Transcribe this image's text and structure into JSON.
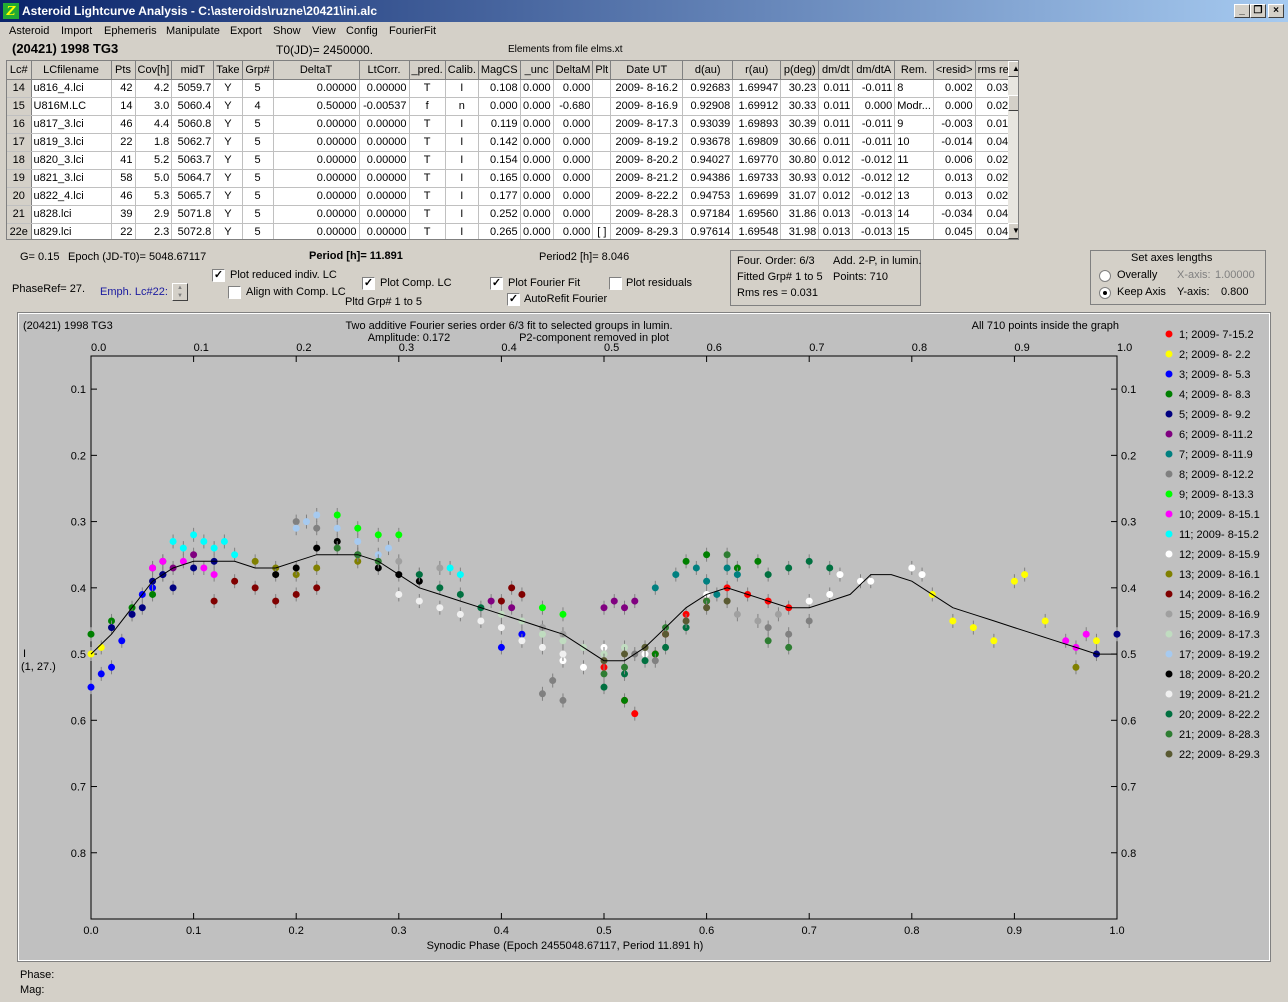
{
  "window": {
    "title": "Asteroid Lightcurve Analysis - C:\\asteroids\\ruzne\\20421\\ini.alc",
    "app_icon": "Z",
    "min_icon": "_",
    "restore_icon": "❐",
    "close_icon": "×"
  },
  "menu": [
    "Asteroid",
    "Import",
    "Ephemeris",
    "Manipulate",
    "Export",
    "Show",
    "View",
    "Config",
    "FourierFit"
  ],
  "header": {
    "object": "(20421) 1998 TG3",
    "t0": "T0(JD)= 2450000.",
    "elements": "Elements from file elms.xt"
  },
  "table": {
    "columns": [
      "Lc#",
      "LCfilename",
      "Pts",
      "Cov[h]",
      "midT",
      "Take",
      "Grp#",
      "DeltaT",
      "LtCorr.",
      "_pred.",
      "Calib.",
      "MagCS",
      "_unc",
      "DeltaM",
      "Plt",
      "Date UT",
      "d(au)",
      "r(au)",
      "p(deg)",
      "dm/dt",
      "dm/dtA",
      "Rem.",
      "<resid>",
      "rms res"
    ],
    "rows": [
      [
        "14",
        "u816_4.lci",
        "42",
        "4.2",
        "5059.7",
        "Y",
        "5",
        "0.00000",
        "0.00000",
        "T",
        "I",
        "0.108",
        "0.000",
        "0.000",
        "",
        "2009- 8-16.2",
        "0.92683",
        "1.69947",
        "30.23",
        "0.011",
        "-0.011",
        "8",
        "0.002",
        "0.032"
      ],
      [
        "15",
        "U816M.LC",
        "14",
        "3.0",
        "5060.4",
        "Y",
        "4",
        "0.50000",
        "-0.00537",
        "f",
        "n",
        "0.000",
        "0.000",
        "-0.680",
        "",
        "2009- 8-16.9",
        "0.92908",
        "1.69912",
        "30.33",
        "0.011",
        "0.000",
        "Modr...",
        "0.000",
        "0.023"
      ],
      [
        "16",
        "u817_3.lci",
        "46",
        "4.4",
        "5060.8",
        "Y",
        "5",
        "0.00000",
        "0.00000",
        "T",
        "I",
        "0.119",
        "0.000",
        "0.000",
        "",
        "2009- 8-17.3",
        "0.93039",
        "1.69893",
        "30.39",
        "0.011",
        "-0.011",
        "9",
        "-0.003",
        "0.015"
      ],
      [
        "17",
        "u819_3.lci",
        "22",
        "1.8",
        "5062.7",
        "Y",
        "5",
        "0.00000",
        "0.00000",
        "T",
        "I",
        "0.142",
        "0.000",
        "0.000",
        "",
        "2009- 8-19.2",
        "0.93678",
        "1.69809",
        "30.66",
        "0.011",
        "-0.011",
        "10",
        "-0.014",
        "0.042"
      ],
      [
        "18",
        "u820_3.lci",
        "41",
        "5.2",
        "5063.7",
        "Y",
        "5",
        "0.00000",
        "0.00000",
        "T",
        "I",
        "0.154",
        "0.000",
        "0.000",
        "",
        "2009- 8-20.2",
        "0.94027",
        "1.69770",
        "30.80",
        "0.012",
        "-0.012",
        "11",
        "0.006",
        "0.024"
      ],
      [
        "19",
        "u821_3.lci",
        "58",
        "5.0",
        "5064.7",
        "Y",
        "5",
        "0.00000",
        "0.00000",
        "T",
        "I",
        "0.165",
        "0.000",
        "0.000",
        "",
        "2009- 8-21.2",
        "0.94386",
        "1.69733",
        "30.93",
        "0.012",
        "-0.012",
        "12",
        "0.013",
        "0.021"
      ],
      [
        "20",
        "u822_4.lci",
        "46",
        "5.3",
        "5065.7",
        "Y",
        "5",
        "0.00000",
        "0.00000",
        "T",
        "I",
        "0.177",
        "0.000",
        "0.000",
        "",
        "2009- 8-22.2",
        "0.94753",
        "1.69699",
        "31.07",
        "0.012",
        "-0.012",
        "13",
        "0.013",
        "0.028"
      ],
      [
        "21",
        "u828.lci",
        "39",
        "2.9",
        "5071.8",
        "Y",
        "5",
        "0.00000",
        "0.00000",
        "T",
        "I",
        "0.252",
        "0.000",
        "0.000",
        "",
        "2009- 8-28.3",
        "0.97184",
        "1.69560",
        "31.86",
        "0.013",
        "-0.013",
        "14",
        "-0.034",
        "0.044"
      ],
      [
        "22e",
        "u829.lci",
        "22",
        "2.3",
        "5072.8",
        "Y",
        "5",
        "0.00000",
        "0.00000",
        "T",
        "I",
        "0.265",
        "0.000",
        "0.000",
        "[ ]",
        "2009- 8-29.3",
        "0.97614",
        "1.69548",
        "31.98",
        "0.013",
        "-0.013",
        "15",
        "0.045",
        "0.048"
      ]
    ]
  },
  "controls": {
    "g": "G= 0.15",
    "epoch": "Epoch (JD-T0)= 5048.67117",
    "period": "Period [h]= 11.891",
    "period2": "Period2 [h]= 8.046",
    "phaseref": "PhaseRef= 27.",
    "emph": "Emph. Lc#22:",
    "plot_reduced": "Plot reduced indiv. LC",
    "align": "Align with Comp. LC",
    "plot_comp": "Plot Comp. LC",
    "pltd_grp": "Pltd Grp#  1   to   5",
    "plot_fourier": "Plot Fourier Fit",
    "autorefit": "AutoRefit Fourier",
    "plot_resid": "Plot residuals",
    "check_mark": "✓"
  },
  "fourier_box": {
    "order": "Four. Order:  6/3",
    "add": "Add. 2-P, in lumin.",
    "fitted": "Fitted Grp# 1 to 5",
    "points": "Points: 710",
    "rms": "Rms res     = 0.031"
  },
  "axes_box": {
    "title": "Set axes lengths",
    "overall": "Overally",
    "keep": "Keep Axis",
    "xaxis_label": "X-axis:",
    "xaxis_value": "1.00000",
    "yaxis_label": "Y-axis:",
    "yaxis_value": "0.800"
  },
  "status": {
    "phase": "Phase:",
    "mag": "Mag:"
  },
  "chart_data": {
    "type": "scatter",
    "title_left": "(20421) 1998 TG3",
    "title_center": "Two additive Fourier series order 6/3 fit to selected groups in lumin.",
    "amplitude": "Amplitude: 0.172",
    "p2_note": "P2-component removed in plot",
    "title_right": "All 710 points inside the graph",
    "xlabel": "Synodic Phase (Epoch 2455048.67117, Period 11.891 h)",
    "ylabel": "I",
    "ylabel2": "(1, 27.)",
    "xlim": [
      0,
      1
    ],
    "ylim": [
      0.9,
      0.05
    ],
    "xticks": [
      "0.0",
      "0.1",
      "0.2",
      "0.3",
      "0.4",
      "0.5",
      "0.6",
      "0.7",
      "0.8",
      "0.9",
      "1.0"
    ],
    "yticks": [
      "0.1",
      "0.2",
      "0.3",
      "0.4",
      "0.5",
      "0.6",
      "0.7",
      "0.8"
    ],
    "series": [
      {
        "name": "1; 2009- 7-15.2",
        "color": "#ff0000",
        "x": [
          0.5,
          0.52,
          0.53,
          0.55,
          0.56,
          0.58,
          0.6,
          0.62,
          0.64,
          0.66,
          0.68
        ],
        "y": [
          0.52,
          0.57,
          0.59,
          0.5,
          0.47,
          0.44,
          0.42,
          0.4,
          0.41,
          0.42,
          0.43
        ]
      },
      {
        "name": "2; 2009- 8- 2.2",
        "color": "#ffff00",
        "x": [
          0.0,
          0.01,
          0.82,
          0.84,
          0.86,
          0.88,
          0.9,
          0.91,
          0.93,
          0.98
        ],
        "y": [
          0.5,
          0.49,
          0.41,
          0.45,
          0.46,
          0.48,
          0.39,
          0.38,
          0.45,
          0.48
        ]
      },
      {
        "name": "3; 2009- 8- 5.3",
        "color": "#0000ff",
        "x": [
          0.0,
          0.01,
          0.02,
          0.03,
          0.04,
          0.05,
          0.06,
          0.07,
          0.4,
          0.42
        ],
        "y": [
          0.55,
          0.53,
          0.52,
          0.48,
          0.44,
          0.41,
          0.4,
          0.38,
          0.49,
          0.47
        ]
      },
      {
        "name": "4; 2009- 8- 8.3",
        "color": "#007f00",
        "x": [
          0.0,
          0.02,
          0.04,
          0.06,
          0.52,
          0.55,
          0.58,
          0.6,
          0.63,
          0.65
        ],
        "y": [
          0.47,
          0.45,
          0.43,
          0.41,
          0.57,
          0.5,
          0.36,
          0.35,
          0.37,
          0.36
        ]
      },
      {
        "name": "5; 2009- 8- 9.2",
        "color": "#000080",
        "x": [
          0.02,
          0.04,
          0.05,
          0.06,
          0.07,
          0.08,
          0.1,
          0.12,
          0.98,
          1.0
        ],
        "y": [
          0.46,
          0.44,
          0.43,
          0.39,
          0.38,
          0.4,
          0.37,
          0.36,
          0.5,
          0.47
        ]
      },
      {
        "name": "6; 2009- 8-11.2",
        "color": "#800080",
        "x": [
          0.06,
          0.07,
          0.08,
          0.1,
          0.39,
          0.41,
          0.5,
          0.51,
          0.52,
          0.53
        ],
        "y": [
          0.37,
          0.36,
          0.37,
          0.35,
          0.42,
          0.43,
          0.43,
          0.42,
          0.43,
          0.42
        ]
      },
      {
        "name": "7; 2009- 8-11.9",
        "color": "#008080",
        "x": [
          0.55,
          0.57,
          0.59,
          0.6,
          0.61,
          0.62,
          0.63
        ],
        "y": [
          0.4,
          0.38,
          0.37,
          0.39,
          0.41,
          0.37,
          0.38
        ]
      },
      {
        "name": "8; 2009- 8-12.2",
        "color": "#808080",
        "x": [
          0.2,
          0.22,
          0.44,
          0.45,
          0.46,
          0.53,
          0.55,
          0.66,
          0.68,
          0.7
        ],
        "y": [
          0.3,
          0.31,
          0.56,
          0.54,
          0.57,
          0.5,
          0.51,
          0.46,
          0.47,
          0.45
        ]
      },
      {
        "name": "9; 2009- 8-13.3",
        "color": "#00ff00",
        "x": [
          0.24,
          0.26,
          0.28,
          0.3,
          0.44,
          0.46
        ],
        "y": [
          0.29,
          0.31,
          0.32,
          0.32,
          0.43,
          0.44
        ]
      },
      {
        "name": "10; 2009- 8-15.1",
        "color": "#ff00ff",
        "x": [
          0.06,
          0.07,
          0.09,
          0.11,
          0.12,
          0.95,
          0.96,
          0.97
        ],
        "y": [
          0.37,
          0.36,
          0.36,
          0.37,
          0.38,
          0.48,
          0.49,
          0.47
        ]
      },
      {
        "name": "11; 2009- 8-15.2",
        "color": "#00ffff",
        "x": [
          0.08,
          0.09,
          0.1,
          0.11,
          0.12,
          0.13,
          0.14,
          0.35,
          0.36
        ],
        "y": [
          0.33,
          0.34,
          0.32,
          0.33,
          0.34,
          0.33,
          0.35,
          0.37,
          0.38
        ]
      },
      {
        "name": "12; 2009- 8-15.9",
        "color": "#ffffff",
        "x": [
          0.46,
          0.48,
          0.5,
          0.52,
          0.54,
          0.56,
          0.6,
          0.7,
          0.72,
          0.73,
          0.75,
          0.76,
          0.8,
          0.81
        ],
        "y": [
          0.51,
          0.52,
          0.49,
          0.5,
          0.5,
          0.46,
          0.41,
          0.42,
          0.41,
          0.38,
          0.39,
          0.39,
          0.37,
          0.38
        ]
      },
      {
        "name": "13; 2009- 8-16.1",
        "color": "#808000",
        "x": [
          0.16,
          0.18,
          0.2,
          0.22,
          0.26,
          0.96
        ],
        "y": [
          0.36,
          0.37,
          0.38,
          0.37,
          0.36,
          0.52
        ]
      },
      {
        "name": "14; 2009- 8-16.2",
        "color": "#800000",
        "x": [
          0.12,
          0.14,
          0.16,
          0.18,
          0.2,
          0.22,
          0.4,
          0.41,
          0.42
        ],
        "y": [
          0.42,
          0.39,
          0.4,
          0.42,
          0.41,
          0.4,
          0.42,
          0.4,
          0.41
        ]
      },
      {
        "name": "15; 2009- 8-16.9",
        "color": "#a0a0a0",
        "x": [
          0.3,
          0.32,
          0.34,
          0.44,
          0.46,
          0.63,
          0.65,
          0.67
        ],
        "y": [
          0.36,
          0.38,
          0.37,
          0.46,
          0.47,
          0.44,
          0.45,
          0.44
        ]
      },
      {
        "name": "16; 2009- 8-17.3",
        "color": "#c0dcc0",
        "x": [
          0.4,
          0.42,
          0.44,
          0.46,
          0.48,
          0.5,
          0.52
        ],
        "y": [
          0.44,
          0.45,
          0.47,
          0.48,
          0.49,
          0.5,
          0.49
        ]
      },
      {
        "name": "17; 2009- 8-19.2",
        "color": "#a6caf0",
        "x": [
          0.2,
          0.21,
          0.22,
          0.24,
          0.26,
          0.28,
          0.29
        ],
        "y": [
          0.31,
          0.3,
          0.29,
          0.31,
          0.33,
          0.35,
          0.34
        ]
      },
      {
        "name": "18; 2009- 8-20.2",
        "color": "#000000",
        "x": [
          0.18,
          0.2,
          0.22,
          0.24,
          0.26,
          0.28,
          0.3,
          0.32
        ],
        "y": [
          0.38,
          0.37,
          0.34,
          0.33,
          0.35,
          0.37,
          0.38,
          0.39
        ]
      },
      {
        "name": "19; 2009- 8-21.2",
        "color": "#f0f0f0",
        "x": [
          0.3,
          0.32,
          0.34,
          0.36,
          0.38,
          0.4,
          0.42,
          0.44,
          0.46
        ],
        "y": [
          0.41,
          0.42,
          0.43,
          0.44,
          0.45,
          0.46,
          0.48,
          0.49,
          0.5
        ]
      },
      {
        "name": "20; 2009- 8-22.2",
        "color": "#007040",
        "x": [
          0.32,
          0.34,
          0.36,
          0.38,
          0.5,
          0.52,
          0.54,
          0.56,
          0.58,
          0.66,
          0.68,
          0.7,
          0.72
        ],
        "y": [
          0.38,
          0.4,
          0.41,
          0.43,
          0.55,
          0.53,
          0.51,
          0.49,
          0.46,
          0.38,
          0.37,
          0.36,
          0.37
        ]
      },
      {
        "name": "21; 2009- 8-28.3",
        "color": "#2e7d32",
        "x": [
          0.24,
          0.26,
          0.28,
          0.5,
          0.52,
          0.54,
          0.56,
          0.6,
          0.62,
          0.66,
          0.68
        ],
        "y": [
          0.34,
          0.35,
          0.36,
          0.53,
          0.52,
          0.49,
          0.46,
          0.42,
          0.35,
          0.48,
          0.49
        ]
      },
      {
        "name": "22; 2009- 8-29.3",
        "color": "#5a5a32",
        "x": [
          0.5,
          0.52,
          0.54,
          0.56,
          0.58,
          0.6,
          0.62
        ],
        "y": [
          0.51,
          0.5,
          0.49,
          0.47,
          0.45,
          0.43,
          0.42
        ]
      }
    ],
    "fit_curve": {
      "x": [
        0.0,
        0.02,
        0.04,
        0.06,
        0.08,
        0.1,
        0.12,
        0.14,
        0.16,
        0.18,
        0.2,
        0.22,
        0.24,
        0.26,
        0.28,
        0.3,
        0.32,
        0.34,
        0.36,
        0.38,
        0.4,
        0.42,
        0.44,
        0.46,
        0.48,
        0.5,
        0.52,
        0.54,
        0.56,
        0.58,
        0.6,
        0.62,
        0.64,
        0.66,
        0.68,
        0.7,
        0.72,
        0.74,
        0.76,
        0.78,
        0.8,
        0.82,
        0.84,
        0.86,
        0.88,
        0.9,
        0.92,
        0.94,
        0.96,
        0.98,
        1.0
      ],
      "y": [
        0.5,
        0.47,
        0.43,
        0.39,
        0.37,
        0.36,
        0.36,
        0.36,
        0.37,
        0.37,
        0.36,
        0.35,
        0.35,
        0.35,
        0.36,
        0.38,
        0.4,
        0.41,
        0.42,
        0.43,
        0.44,
        0.45,
        0.46,
        0.47,
        0.49,
        0.51,
        0.51,
        0.49,
        0.46,
        0.43,
        0.41,
        0.4,
        0.41,
        0.42,
        0.43,
        0.43,
        0.42,
        0.41,
        0.38,
        0.38,
        0.39,
        0.41,
        0.43,
        0.44,
        0.45,
        0.46,
        0.47,
        0.48,
        0.49,
        0.5,
        0.5
      ]
    }
  }
}
